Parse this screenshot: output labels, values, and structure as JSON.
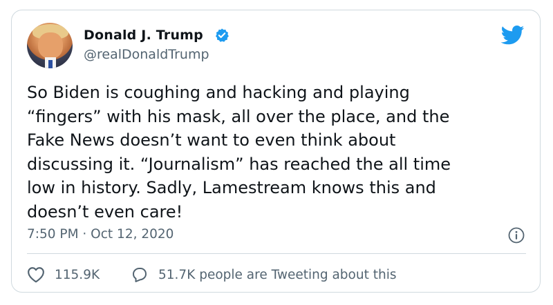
{
  "tweet": {
    "author_name": "Donald J. Trump",
    "author_handle": "@realDonaldTrump",
    "text": "So Biden is coughing and hacking and playing\n“fingers” with his mask, all over the place, and the\nFake News doesn’t want to even think about\ndiscussing it. “Journalism” has reached the all time\nlow in history. Sadly, Lamestream knows this and\ndoesn’t even care!",
    "timestamp": "7:50 PM · Oct 12, 2020"
  },
  "metrics": {
    "likes": "115.9K",
    "tweeting": "51.7K people are Tweeting about this"
  },
  "icons": {
    "verified": "verified-badge-icon",
    "brand": "twitter-bird-icon",
    "info": "info-icon",
    "like": "heart-icon",
    "reply": "speech-bubble-icon"
  },
  "colors": {
    "brand": "#1d9bf0",
    "text": "#0f1419",
    "secondary": "#536471",
    "border": "#cfd9de"
  }
}
